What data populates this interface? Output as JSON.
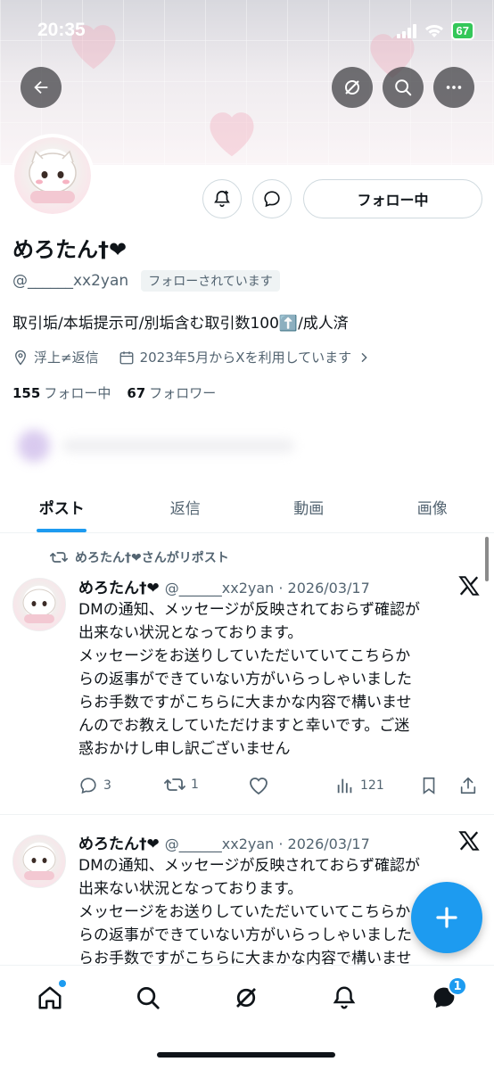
{
  "status_bar": {
    "time": "20:35",
    "battery": "67"
  },
  "profile": {
    "name": "めろたん†❤",
    "handle": "@______xx2yan",
    "follows_you": "フォローされています",
    "bio": "取引垢/本垢提示可/別垢含む取引数100⬆️/成人済",
    "location": "浮上≠返信",
    "joined": "2023年5月からXを利用しています",
    "following_count": "155",
    "following_label": "フォロー中",
    "followers_count": "67",
    "followers_label": "フォロワー",
    "follow_button": "フォロー中"
  },
  "tabs": [
    {
      "label": "ポスト"
    },
    {
      "label": "返信"
    },
    {
      "label": "動画"
    },
    {
      "label": "画像"
    }
  ],
  "feed": {
    "repost_label": "めろたん†❤さんがリポスト",
    "posts": [
      {
        "name": "めろたん†❤",
        "meta": "@______xx2yan · 2026/03/17",
        "lines": [
          "DMの通知、メッセージが反映されておらず確認が",
          "出来ない状況となっております。",
          "メッセージをお送りしていただいていてこちらか",
          "らの返事ができていない方がいらっしゃいました",
          "らお手数ですがこちらに大まかな内容で構いませ",
          "んのでお教えしていただけますと幸いです。ご迷",
          "惑おかけし申し訳ございません"
        ],
        "replies": "3",
        "reposts": "1",
        "views": "121"
      },
      {
        "name": "めろたん†❤",
        "meta": "@______xx2yan · 2026/03/17",
        "lines": [
          "DMの通知、メッセージが反映されておらず確認が",
          "出来ない状況となっております。",
          "メッセージをお送りしていただいていてこちらか",
          "らの返事ができていない方がいらっしゃいました",
          "らお手数ですがこちらに大まかな内容で構いませ"
        ]
      }
    ]
  },
  "bottom_nav": {
    "messages_badge": "1"
  },
  "colors": {
    "accent": "#1d9bf0",
    "text": "#0f1419",
    "muted": "#536471"
  }
}
